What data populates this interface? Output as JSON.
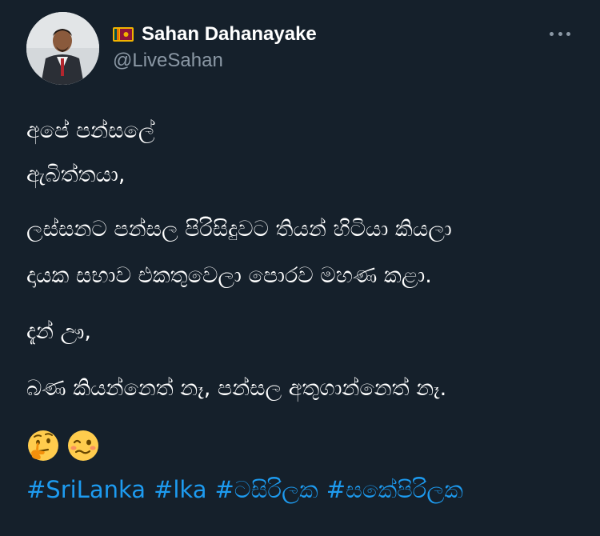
{
  "author": {
    "display_name": "Sahan Dahanayake",
    "handle": "@LiveSahan",
    "flag_icon": "sri-lanka-flag-icon"
  },
  "tweet": {
    "lines": [
      "අපේ පන්සලේ",
      "ඇබිත්තයා,",
      "ලස්සනට පන්සල පිරිසිදුවට තියන් හිටියා කියලා",
      "දායක සභාව එකතුවෙලා පොරව මහණ කළා.",
      "දැන් ඌ,",
      "බණ කියන්නෙත් නෑ, පන්සල අතුගාන්නෙත් නෑ."
    ],
    "emojis": [
      "thinking-face-icon",
      "woozy-face-icon"
    ],
    "hashtags": [
      "#SriLanka",
      "#lka",
      "#ටසිරිලක",
      "#සකේපිරිලක"
    ]
  },
  "colors": {
    "background": "#15202b",
    "text": "#ffffff",
    "secondary_text": "#8b98a5",
    "link": "#1d9bf0"
  }
}
